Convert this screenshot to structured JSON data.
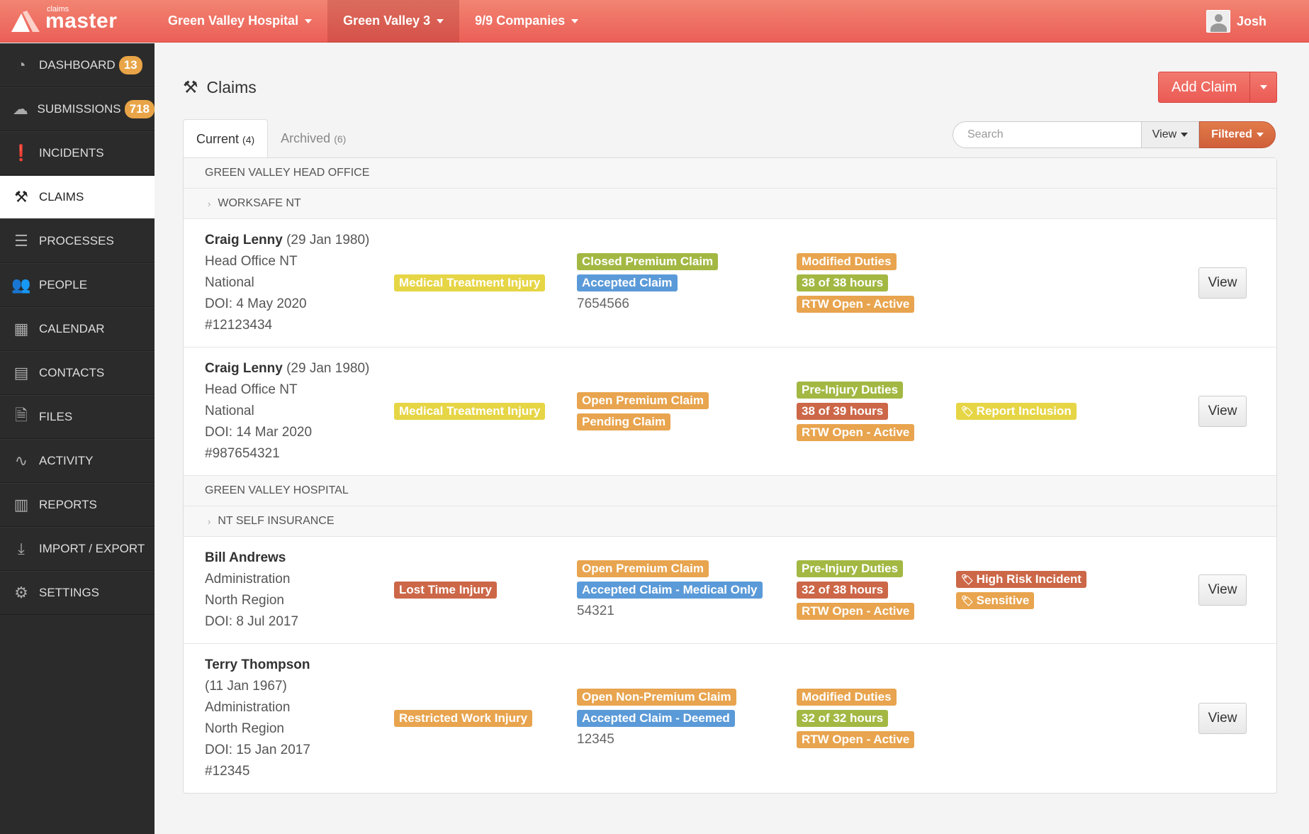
{
  "brand": {
    "small": "claims",
    "big": "master"
  },
  "topnav": [
    {
      "label": "Green Valley Hospital"
    },
    {
      "label": "Green Valley 3",
      "active": true
    },
    {
      "label": "9/9 Companies"
    }
  ],
  "user": {
    "name": "Josh"
  },
  "sidebar": [
    {
      "label": "DASHBOARD",
      "badge": "13",
      "icon": "dashboard-icon",
      "glyph": "◔"
    },
    {
      "label": "SUBMISSIONS",
      "badge": "718",
      "icon": "cloud-upload-icon",
      "glyph": "☁"
    },
    {
      "label": "INCIDENTS",
      "icon": "alert-icon",
      "glyph": "❗"
    },
    {
      "label": "CLAIMS",
      "icon": "gavel-icon",
      "glyph": "⚒",
      "active": true
    },
    {
      "label": "PROCESSES",
      "icon": "processes-icon",
      "glyph": "☰"
    },
    {
      "label": "PEOPLE",
      "icon": "people-icon",
      "glyph": "👥"
    },
    {
      "label": "CALENDAR",
      "icon": "calendar-icon",
      "glyph": "▦"
    },
    {
      "label": "CONTACTS",
      "icon": "contacts-icon",
      "glyph": "▤"
    },
    {
      "label": "FILES",
      "icon": "file-icon",
      "glyph": "🗎"
    },
    {
      "label": "ACTIVITY",
      "icon": "activity-icon",
      "glyph": "∿"
    },
    {
      "label": "REPORTS",
      "icon": "bar-chart-icon",
      "glyph": "▥"
    },
    {
      "label": "IMPORT / EXPORT",
      "icon": "download-icon",
      "glyph": "⤓"
    },
    {
      "label": "SETTINGS",
      "icon": "gear-icon",
      "glyph": "⚙"
    }
  ],
  "page": {
    "title": "Claims",
    "add_label": "Add Claim"
  },
  "tabs": [
    {
      "label": "Current",
      "count": "(4)",
      "active": true
    },
    {
      "label": "Archived",
      "count": "(6)"
    }
  ],
  "search": {
    "placeholder": "Search",
    "value": "",
    "view_label": "View",
    "filter_label": "Filtered"
  },
  "colors": {
    "yellow": "#e6d545",
    "green": "#a2b843",
    "blue": "#5b9ad8",
    "orange": "#e8a44e",
    "red": "#cc6748",
    "accent": "#eb5f57"
  },
  "groups": [
    {
      "name": "GREEN VALLEY HEAD OFFICE",
      "sub": "WORKSAFE NT",
      "rows": [
        {
          "name": "Craig Lenny",
          "dob": "(29 Jan 1980)",
          "lines": [
            "Head Office NT",
            "National",
            "DOI: 4 May 2020",
            "#12123434"
          ],
          "h": 181,
          "injury": [
            {
              "t": "Medical Treatment Injury",
              "c": "yellow"
            }
          ],
          "claim": [
            {
              "t": "Closed Premium Claim",
              "c": "green"
            },
            {
              "t": "Accepted Claim",
              "c": "blue"
            }
          ],
          "claim_no": "7654566",
          "duties": [
            {
              "t": "Modified Duties",
              "c": "orange"
            },
            {
              "t": "38 of 38 hours",
              "c": "green"
            },
            {
              "t": "RTW Open - Active",
              "c": "orange"
            }
          ],
          "flags": [],
          "view": "View"
        },
        {
          "name": "Craig Lenny",
          "dob": "(29 Jan 1980)",
          "lines": [
            "Head Office NT",
            "National",
            "DOI: 14 Mar 2020",
            "#987654321"
          ],
          "h": 181,
          "injury": [
            {
              "t": "Medical Treatment Injury",
              "c": "yellow"
            }
          ],
          "claim": [
            {
              "t": "Open Premium Claim",
              "c": "orange"
            },
            {
              "t": "Pending Claim",
              "c": "orange"
            }
          ],
          "duties": [
            {
              "t": "Pre-Injury Duties",
              "c": "green"
            },
            {
              "t": "38 of 39 hours",
              "c": "red"
            },
            {
              "t": "RTW Open - Active",
              "c": "orange"
            }
          ],
          "flags": [
            {
              "t": "Report Inclusion",
              "c": "yellow"
            }
          ],
          "view": "View"
        }
      ]
    },
    {
      "name": "GREEN VALLEY HOSPITAL",
      "sub": "NT SELF INSURANCE",
      "rows": [
        {
          "name": "Bill Andrews",
          "dob": "",
          "lines": [
            "Administration",
            "North Region",
            "DOI: 8 Jul 2017"
          ],
          "h": 151,
          "injury": [
            {
              "t": "Lost Time Injury",
              "c": "red"
            }
          ],
          "claim": [
            {
              "t": "Open Premium Claim",
              "c": "orange"
            },
            {
              "t": "Accepted Claim - Medical Only",
              "c": "blue"
            }
          ],
          "claim_no": "54321",
          "duties": [
            {
              "t": "Pre-Injury Duties",
              "c": "green"
            },
            {
              "t": "32 of 38 hours",
              "c": "red"
            },
            {
              "t": "RTW Open - Active",
              "c": "orange"
            }
          ],
          "flags": [
            {
              "t": "High Risk Incident",
              "c": "red"
            },
            {
              "t": "Sensitive",
              "c": "orange"
            }
          ],
          "view": "View"
        },
        {
          "name": "Terry Thompson",
          "dob": "",
          "lines": [
            "(11 Jan 1967)",
            "Administration",
            "North Region",
            "DOI: 15 Jan 2017",
            "#12345"
          ],
          "h": 210,
          "injury": [
            {
              "t": "Restricted Work Injury",
              "c": "orange"
            }
          ],
          "claim": [
            {
              "t": "Open Non-Premium Claim",
              "c": "orange"
            },
            {
              "t": "Accepted Claim - Deemed",
              "c": "blue"
            }
          ],
          "claim_no": "12345",
          "duties": [
            {
              "t": "Modified Duties",
              "c": "orange"
            },
            {
              "t": "32 of 32 hours",
              "c": "green"
            },
            {
              "t": "RTW Open - Active",
              "c": "orange"
            }
          ],
          "flags": [],
          "view": "View"
        }
      ]
    }
  ]
}
